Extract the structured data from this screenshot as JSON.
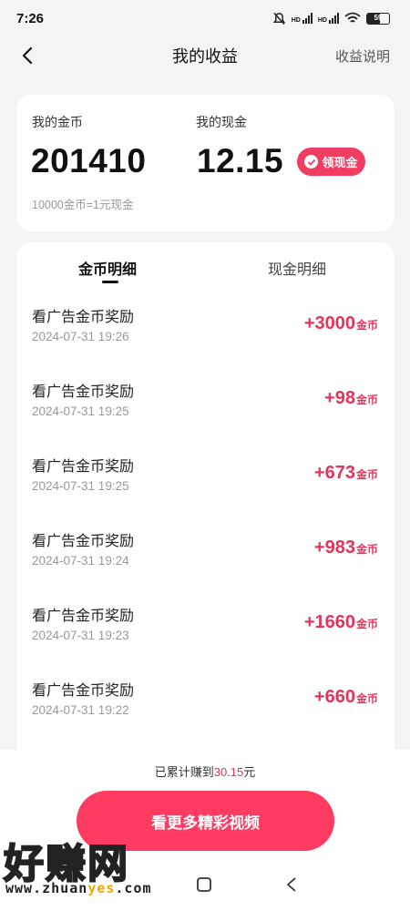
{
  "status_bar": {
    "time": "7:26",
    "battery": "59"
  },
  "header": {
    "title": "我的收益",
    "right_link": "收益说明"
  },
  "summary": {
    "coins_label": "我的金币",
    "coins_value": "201410",
    "cash_label": "我的现金",
    "cash_value": "12.15",
    "claim_button": "领现金",
    "rate_note": "10000金币=1元现金"
  },
  "tabs": [
    {
      "label": "金币明细",
      "active": true
    },
    {
      "label": "现金明细",
      "active": false
    }
  ],
  "records": [
    {
      "title": "看广告金币奖励",
      "time": "2024-07-31 19:26",
      "amount": "+3000",
      "unit": "金币"
    },
    {
      "title": "看广告金币奖励",
      "time": "2024-07-31 19:25",
      "amount": "+98",
      "unit": "金币"
    },
    {
      "title": "看广告金币奖励",
      "time": "2024-07-31 19:25",
      "amount": "+673",
      "unit": "金币"
    },
    {
      "title": "看广告金币奖励",
      "time": "2024-07-31 19:24",
      "amount": "+983",
      "unit": "金币"
    },
    {
      "title": "看广告金币奖励",
      "time": "2024-07-31 19:23",
      "amount": "+1660",
      "unit": "金币"
    },
    {
      "title": "看广告金币奖励",
      "time": "2024-07-31 19:22",
      "amount": "+660",
      "unit": "金币"
    }
  ],
  "footer": {
    "earned_prefix": "已累计赚到",
    "earned_amount": "30.15",
    "earned_suffix": "元",
    "cta_button": "看更多精彩视频"
  },
  "watermark": {
    "text": "好赚网",
    "url_part1": "www.zhuan",
    "url_highlight": "yes",
    "url_part2": ".com"
  },
  "icons": {
    "back": "chevron-left-icon",
    "mute": "bell-off-icon",
    "wifi": "wifi-icon",
    "claim": "cash-icon",
    "home": "square-icon",
    "sys_back": "triangle-back-icon"
  },
  "colors": {
    "accent": "#f23d62",
    "amount": "#e6335a",
    "background": "#f4f4f6"
  }
}
